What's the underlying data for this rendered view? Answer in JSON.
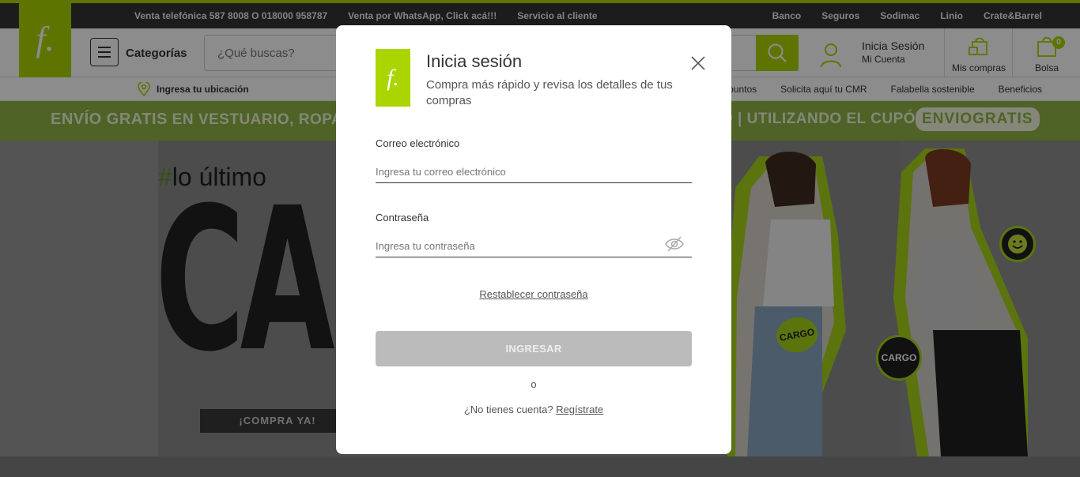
{
  "topbar": {
    "left_links": [
      "Venta telefónica 587 8008 O 018000 958787",
      "Venta por WhatsApp, Click acá!!!",
      "Servicio al cliente"
    ],
    "right_links": [
      "Banco",
      "Seguros",
      "Sodimac",
      "Linio",
      "Crate&Barrel"
    ]
  },
  "brand": {
    "logo_letter": "f.",
    "accent": "#aad500"
  },
  "header": {
    "categories_label": "Categorías",
    "search_placeholder": "¿Qué buscas?",
    "login_label": "Inicia Sesión",
    "account_label": "Mi Cuenta",
    "purchases_label": "Mis compras",
    "bag_label": "Bolsa",
    "bag_count": "0"
  },
  "subnav": {
    "location_label": "Ingresa tu ubicación",
    "links": [
      "puntos",
      "Solicita aquí tu CMR",
      "Falabella sostenible",
      "Beneficios"
    ]
  },
  "promo": {
    "left_bold": "ENVÍO GRATIS",
    "left_text": "EN VESTUARIO, ROPA IN",
    "right_text": "O | UTILIZANDO EL CUPÓN",
    "coupon": "ENVIOGRATIS"
  },
  "hero": {
    "hashtag_symbol": "#",
    "hashtag_text": "lo último",
    "headline": "CARG",
    "cta": "¡COMPRA YA!",
    "sticker_1": "CARGO",
    "sticker_2": "CARGO"
  },
  "modal": {
    "logo_letter": "f.",
    "title": "Inicia sesión",
    "subtitle": "Compra más rápido y revisa los detalles de tus compras",
    "email_label": "Correo electrónico",
    "email_placeholder": "Ingresa tu correo electrónico",
    "password_label": "Contraseña",
    "password_placeholder": "Ingresa tu contraseña",
    "reset_link": "Restablecer contraseña",
    "submit_label": "INGRESAR",
    "or_text": "o",
    "no_account_text": "¿No tienes cuenta?",
    "register_link": "Regístrate"
  }
}
